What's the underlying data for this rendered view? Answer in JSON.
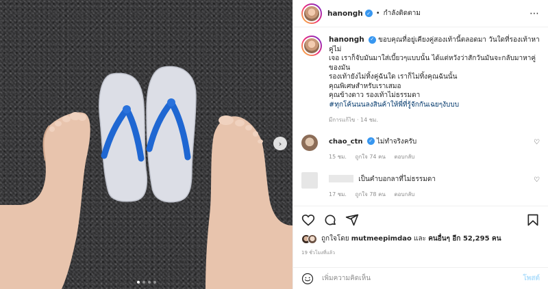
{
  "post": {
    "username": "hanongh",
    "follow_status": "กำลังติดตาม",
    "more_icon": "⋯",
    "caption_lines": [
      "ขอบคุณที่อยู่เคียงคู่สองเท้านี้ตลอดมา วันใดที่รองเท้าหาคู่ไม่",
      "เจอ เราก็จับมันมาใส่เบี้ยวๆแบบนั้น ได้แต่หวังว่าสักวันมันจะกลับมาหาคู่",
      "ของมัน",
      "รองเท้ายังไม่ทิ้งคู่ฉันใด เราก็ไม่ทิ้งคุณฉันนั้น",
      "คุณพิเศษสำหรับเราเสมอ",
      "คุณข้างดาว รองเท้าไม่ธรรมดา"
    ],
    "hashtag": "#ทุกโค้นนนลงสินค้าให้พี่ที่รู้จักกันเฉยๆงับบบ",
    "caption_meta": "มีการแก้ไข · 14 ชม."
  },
  "comments": [
    {
      "username": "chao_ctn",
      "text": "ไม่ทำจริงครับ",
      "time": "15 ชม.",
      "likes": "ถูกใจ 74 คน",
      "reply": "ตอบกลับ"
    },
    {
      "username": "",
      "text": "เป็นคำบอกลาที่ไม่ธรรมดา",
      "time": "17 ชม.",
      "likes": "ถูกใจ 78 คน",
      "reply": "ตอบกลับ"
    }
  ],
  "likes": {
    "prefix": "ถูกใจโดย",
    "user": "mutmeepimdao",
    "middle": "และ",
    "others": "คนอื่นๆ อีก 52,295 คน"
  },
  "timestamp": "19 ชั่วโมงที่แล้ว",
  "add_comment": {
    "placeholder": "เพิ่มความคิดเห็น",
    "post_label": "โพสต์"
  },
  "carousel": {
    "count": 4,
    "active": 1
  },
  "colors": {
    "blue_strap": "#1f67d2",
    "verified": "#3897f0"
  }
}
